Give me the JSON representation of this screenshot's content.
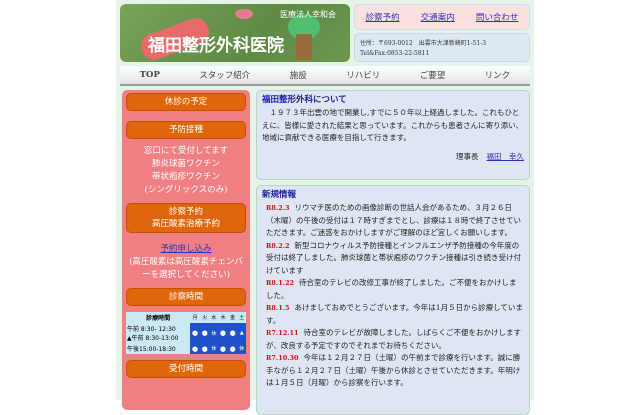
{
  "header": {
    "corp": "医療法人幸和会",
    "hospital": "福田整形外科医院",
    "links": [
      "診察予約",
      "交通案内",
      "問い合わせ"
    ],
    "address": "住所：〒693-0012　出雲市大津新崎町1-51-3",
    "tel": "Tel&Fax:0853-22-5811"
  },
  "nav": [
    "TOP",
    "スタッフ紹介",
    "施設",
    "リハビリ",
    "ご要望",
    "リンク"
  ],
  "sidebar": {
    "closed": "休診の予定",
    "vaccine": "予防接種",
    "vaccine_lines": [
      "窓口にて受付してます",
      "肺炎球菌ワクチン",
      "帯状疱疹ワクチン",
      "(シングリックスのみ)"
    ],
    "reserve_lines": [
      "診察予約",
      "高圧酸素治療予約"
    ],
    "apply_link": "予約申し込み",
    "apply_note": "(高圧酸素は高圧酸素チェンバーを選択してください)",
    "hours": "診察時間",
    "schedule": {
      "header": "診療時間",
      "days": [
        "月",
        "火",
        "水",
        "木",
        "金",
        "土"
      ],
      "rows": [
        {
          "label": "午前 8:30- 12:30",
          "label2": "▲午前 8:30-13:00",
          "cells": [
            "●",
            "●",
            "休",
            "●",
            "●",
            "▲"
          ]
        },
        {
          "label": "午後15:00-18:30",
          "cells": [
            "●",
            "●",
            "休",
            "●",
            "●",
            "休"
          ]
        }
      ]
    },
    "reception": "受付時間"
  },
  "about": {
    "title": "福田整形外科について",
    "text": "　１９７３年出雲の地で開業し,すでに５０年以上経過しました。これもひとえに、皆様に愛された結果と思っています。これからも患者さんに寄り添い、地域に貢献できる医療を目指して行きます。",
    "role": "理事長",
    "name": "福田　幸久"
  },
  "news": {
    "title": "新規情報",
    "items": [
      {
        "date": "R8.2.3",
        "text": "リウマチ医のための画像診断の世話人会があるため、３月２６日（木曜）の午後の受付は１７時すぎまでとし、診療は１８時で終了させていただきます。ご迷惑をおかけしますがご理解のほど宜しくお願いします。"
      },
      {
        "date": "R8.2.2",
        "text": "新型コロナウィルス予防接種とインフルエンザ予防接種の今年度の受付は終了しました。肺炎球菌と帯状疱疹のワクチン接種は引き続き受け付けています"
      },
      {
        "date": "R8.1.22",
        "text": "待合室のテレビの改修工事が終了しました。ご不便をおかけしました。"
      },
      {
        "date": "R8.1.5",
        "text": "あけましておめでとうございます。今年は1月５日から診療しています。"
      },
      {
        "date": "R7.12.11",
        "text": "待合室のテレビが故障しました。しばらくご不便をおかけしますが、改良する予定ですのでそれまでお待ちください。"
      },
      {
        "date": "R7.10.30",
        "text": "今年は１２月２７日（土曜）の午前まで診療を行います。誠に勝手ながら１２月２７日（土曜）午後から休診とさせていただきます。年明けは１月５日（月曜）から診察を行います。"
      }
    ]
  }
}
